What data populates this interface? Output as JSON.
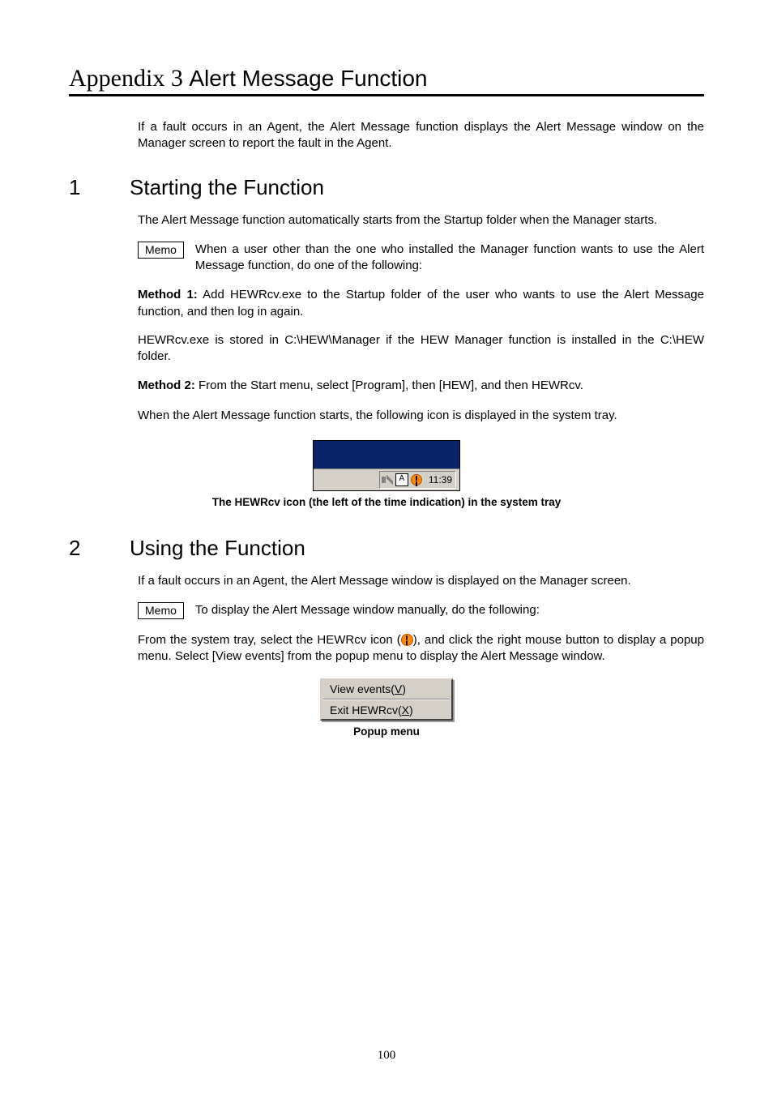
{
  "appendix": {
    "prefix": "Appendix 3 ",
    "title": "Alert Message Function"
  },
  "intro": "If a fault occurs in an Agent, the Alert Message function displays the Alert Message window on the Manager screen to report the fault in the Agent.",
  "s1": {
    "num": "1",
    "heading": "Starting the Function",
    "p1": "The Alert Message function automatically starts from the Startup folder when the Manager starts.",
    "memo_label": "Memo",
    "memo_text": "When a user other than the one who installed the Manager function wants to use the Alert Message function, do one of the following:",
    "m1_label": "Method 1:",
    "m1_text_a": "   Add HEWRcv.exe to the Startup folder of the user who wants to use the Alert Message function, and then log in again.",
    "m1_text_b": "HEWRcv.exe is stored in C:\\HEW\\Manager if the HEW Manager function is installed in the C:\\HEW folder.",
    "m2_label": "Method 2:",
    "m2_text": "   From the Start menu, select [Program], then [HEW], and then HEWRcv.",
    "p2": "When the Alert Message function starts, the following icon is displayed in the system tray.",
    "tray": {
      "ime": "A",
      "time": "11:39"
    },
    "caption": "The HEWRcv icon (the left of the time indication) in the system tray"
  },
  "s2": {
    "num": "2",
    "heading": "Using the Function",
    "p1": "If a fault occurs in an Agent, the Alert Message window is displayed on the Manager screen.",
    "memo_label": "Memo",
    "memo_text": "To display the Alert Message window manually, do the following:",
    "p2a": "From the system tray, select the HEWRcv icon (",
    "p2b": "), and click the right mouse button to display a popup menu. Select [View events] from the popup menu to display the Alert Message window.",
    "popup": {
      "item1_pre": "View events(",
      "item1_u": "V",
      "item1_post": ")",
      "item2_pre": "Exit HEWRcv(",
      "item2_u": "X",
      "item2_post": ")"
    },
    "caption": "Popup menu"
  },
  "page_number": "100"
}
